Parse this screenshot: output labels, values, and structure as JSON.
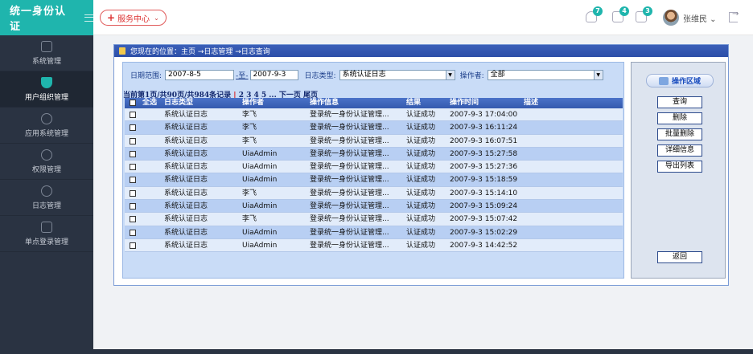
{
  "brand": {
    "title": "统一身份认证"
  },
  "header": {
    "service_label": "服务中心",
    "badges": {
      "bell": "7",
      "mail": "4",
      "doc": "3"
    },
    "username": "张维民"
  },
  "sidebar": {
    "items": [
      {
        "label": "系统管理"
      },
      {
        "label": "用户组织管理"
      },
      {
        "label": "应用系统管理"
      },
      {
        "label": "权限管理"
      },
      {
        "label": "日志管理"
      },
      {
        "label": "单点登录管理"
      }
    ]
  },
  "location": {
    "text": "您现在的位置：主页 →日志管理 →日志查询"
  },
  "filter": {
    "date_label": "日期范围:",
    "date_from": "2007-8-5",
    "to_label": "-至-",
    "date_to": "2007-9-3",
    "type_label": "日志类型:",
    "type_value": "系统认证日志",
    "operator_label": "操作者:",
    "operator_value": "全部"
  },
  "pager": {
    "summary": "当前第1页/共90页/共984条记录",
    "sep": "|",
    "pages": "2 3 4 5 ...",
    "next": "下一页",
    "last": "尾页"
  },
  "grid": {
    "headers": {
      "select_all": "全选",
      "type": "日志类型",
      "operator": "操作者",
      "info": "操作信息",
      "result": "结果",
      "time": "操作时间",
      "desc": "描述"
    },
    "rows": [
      {
        "type": "系统认证日志",
        "operator": "李飞",
        "info": "登录统一身份认证管理...",
        "result": "认证成功",
        "time": "2007-9-3 17:04:00"
      },
      {
        "type": "系统认证日志",
        "operator": "李飞",
        "info": "登录统一身份认证管理...",
        "result": "认证成功",
        "time": "2007-9-3 16:11:24"
      },
      {
        "type": "系统认证日志",
        "operator": "李飞",
        "info": "登录统一身份认证管理...",
        "result": "认证成功",
        "time": "2007-9-3 16:07:51"
      },
      {
        "type": "系统认证日志",
        "operator": "UiaAdmin",
        "info": "登录统一身份认证管理...",
        "result": "认证成功",
        "time": "2007-9-3 15:27:58"
      },
      {
        "type": "系统认证日志",
        "operator": "UiaAdmin",
        "info": "登录统一身份认证管理...",
        "result": "认证成功",
        "time": "2007-9-3 15:27:36"
      },
      {
        "type": "系统认证日志",
        "operator": "UiaAdmin",
        "info": "登录统一身份认证管理...",
        "result": "认证成功",
        "time": "2007-9-3 15:18:59"
      },
      {
        "type": "系统认证日志",
        "operator": "李飞",
        "info": "登录统一身份认证管理...",
        "result": "认证成功",
        "time": "2007-9-3 15:14:10"
      },
      {
        "type": "系统认证日志",
        "operator": "UiaAdmin",
        "info": "登录统一身份认证管理...",
        "result": "认证成功",
        "time": "2007-9-3 15:09:24"
      },
      {
        "type": "系统认证日志",
        "operator": "李飞",
        "info": "登录统一身份认证管理...",
        "result": "认证成功",
        "time": "2007-9-3 15:07:42"
      },
      {
        "type": "系统认证日志",
        "operator": "UiaAdmin",
        "info": "登录统一身份认证管理...",
        "result": "认证成功",
        "time": "2007-9-3 15:02:29"
      },
      {
        "type": "系统认证日志",
        "operator": "UiaAdmin",
        "info": "登录统一身份认证管理...",
        "result": "认证成功",
        "time": "2007-9-3 14:42:52"
      }
    ]
  },
  "actions": {
    "title": "操作区域",
    "query": "查询",
    "delete": "删除",
    "batch_delete": "批量删除",
    "detail": "详细信息",
    "export": "导出列表",
    "back": "返回"
  },
  "colors": {
    "brand": "#1fb5ad",
    "sidebar": "#2a3342",
    "grid_header": "#3459ae",
    "pager_separator": "#d11111"
  }
}
